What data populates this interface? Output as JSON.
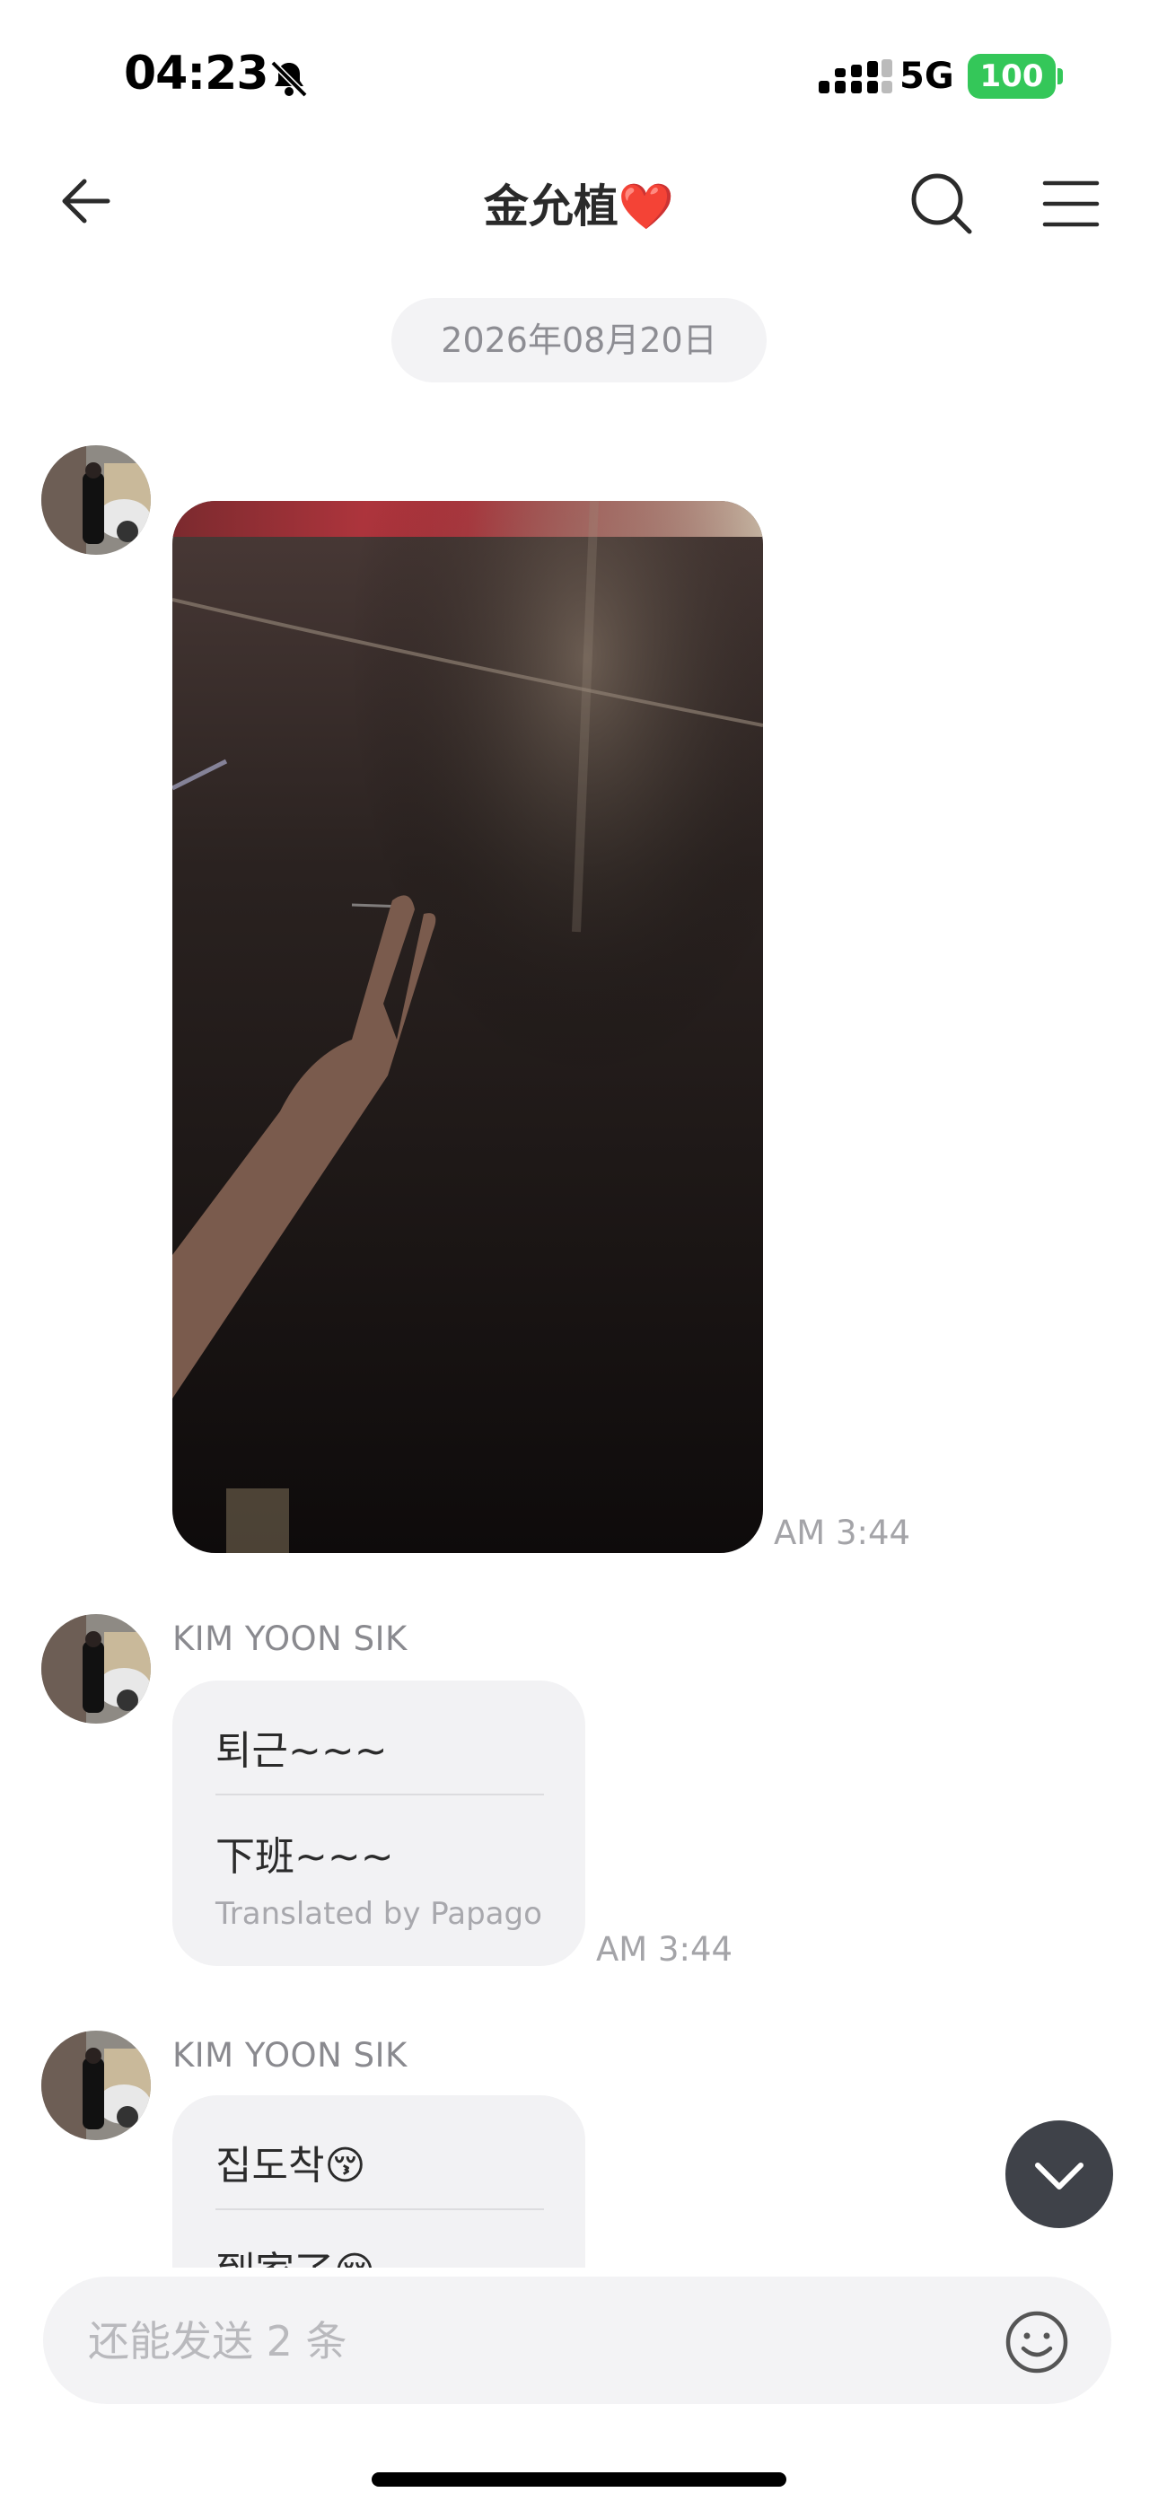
{
  "status_bar": {
    "time": "04:23",
    "network": "5G",
    "battery": "100"
  },
  "header": {
    "title": "金允植",
    "title_emoji": "❤️"
  },
  "date_separator": "2026年08月20日",
  "messages": [
    {
      "type": "photo",
      "time": "AM 3:44"
    },
    {
      "type": "text",
      "sender": "KIM YOON SIK",
      "original": "퇴근~~~",
      "translated": "下班~~~",
      "translation_note": "Translated by Papago",
      "time": "AM 3:44"
    },
    {
      "type": "text",
      "sender": "KIM YOON SIK",
      "original": "집도착😚",
      "translated": "到家了😚"
    }
  ],
  "input": {
    "placeholder": "还能发送 2 条"
  },
  "icons": {
    "status": [
      "bell-slash-icon",
      "signal-icon",
      "battery-icon"
    ],
    "header": [
      "back-arrow-icon",
      "search-icon",
      "menu-icon"
    ],
    "footer": [
      "chevron-down-icon",
      "emoji-icon"
    ]
  },
  "colors": {
    "battery": "#34c759",
    "bubble": "#f2f2f4",
    "scroll_button": "#3f4249",
    "heart": "#e0202e"
  }
}
